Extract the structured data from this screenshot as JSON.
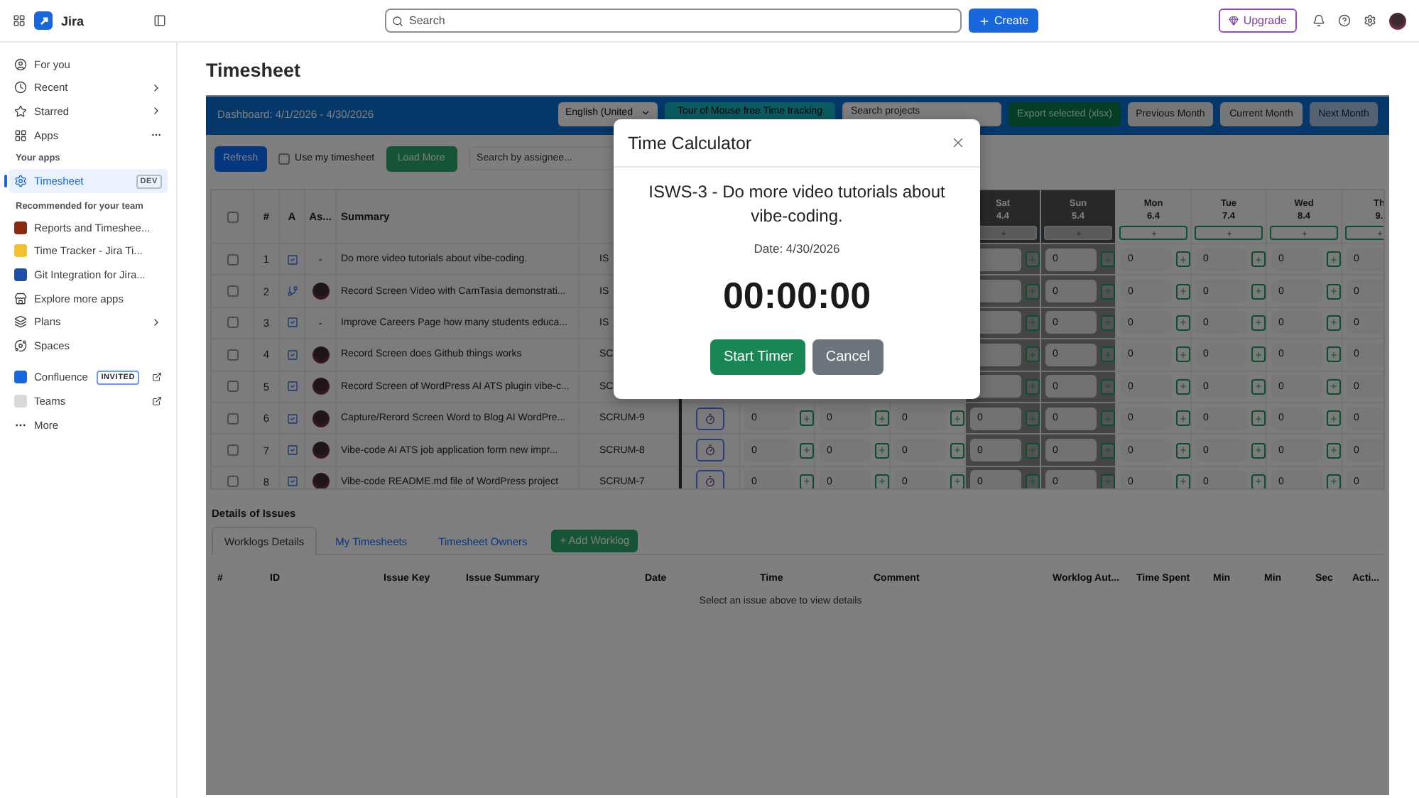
{
  "topbar": {
    "product": "Jira",
    "search_placeholder": "Search",
    "create": "Create",
    "upgrade": "Upgrade"
  },
  "sidebar": {
    "items": [
      {
        "kind": "nav",
        "label": "For you",
        "selected": false
      },
      {
        "kind": "nav",
        "label": "Recent",
        "selected": false,
        "expandable": true
      },
      {
        "kind": "nav",
        "label": "Starred",
        "selected": false,
        "expandable": true
      },
      {
        "kind": "nav",
        "label": "Apps",
        "selected": false,
        "has_menu": true
      },
      {
        "kind": "heading",
        "label": "Your apps"
      },
      {
        "kind": "nav",
        "label": "Timesheet",
        "selected": true,
        "badge": "DEV"
      },
      {
        "kind": "heading",
        "label": "Recommended for your team"
      },
      {
        "kind": "app",
        "label": "Reports and Timeshee...",
        "color": "#8a2c10",
        "selected": false
      },
      {
        "kind": "app",
        "label": "Time Tracker - Jira Ti...",
        "color": "#f2c230",
        "selected": false
      },
      {
        "kind": "app",
        "label": "Git Integration for Jira...",
        "color": "#1f4fa3",
        "selected": false
      },
      {
        "kind": "nav",
        "label": "Explore more apps",
        "selected": false
      },
      {
        "kind": "nav",
        "label": "Plans",
        "selected": false,
        "expandable": true
      },
      {
        "kind": "nav",
        "label": "Spaces",
        "selected": false
      },
      {
        "kind": "app",
        "label": "Confluence",
        "color": "#1868db",
        "selected": false,
        "badge": "INVITED",
        "external": true
      },
      {
        "kind": "app",
        "label": "Teams",
        "color": "#d9d9d9",
        "selected": false,
        "external": true
      },
      {
        "kind": "nav",
        "label": "More",
        "selected": false
      }
    ]
  },
  "page_title": "Timesheet",
  "header_bar": {
    "dashboard": "Dashboard: 4/1/2026 - 4/30/2026",
    "language": "English (United",
    "tour": "Tour of Mouse free Time tracking",
    "project_search_placeholder": "Search projects",
    "buttons": [
      {
        "label": "Export selected (xlsx)",
        "kind": "export"
      },
      {
        "label": "Previous Month",
        "kind": "nav"
      },
      {
        "label": "Current Month",
        "kind": "nav"
      },
      {
        "label": "Next Month",
        "kind": "current"
      }
    ]
  },
  "toolbar": {
    "refresh": "Refresh",
    "my_timesheet": {
      "label": "Use my timesheet",
      "checked": false
    },
    "load_more": "Load More",
    "assignee_placeholder": "Search by assignee..."
  },
  "table": {
    "all_checked": false,
    "columns": [
      "#",
      "A",
      "As...",
      "Summary"
    ],
    "day_columns": [
      {
        "day": "Sat",
        "date": "4.4",
        "weekend": true
      },
      {
        "day": "Sun",
        "date": "5.4",
        "weekend": true
      },
      {
        "day": "Mon",
        "date": "6.4",
        "weekend": false
      },
      {
        "day": "Tue",
        "date": "7.4",
        "weekend": false
      },
      {
        "day": "Wed",
        "date": "8.4",
        "weekend": false
      },
      {
        "day": "Th",
        "date": "9.",
        "weekend": false
      }
    ],
    "rows": [
      {
        "checked": false,
        "number": "1",
        "kind": "task",
        "avatar": false,
        "assignee": "-",
        "summary": "Do more video tutorials about vibe-coding.",
        "key": "IS",
        "hours": [
          "0",
          "0",
          "0",
          "0",
          "0"
        ]
      },
      {
        "checked": false,
        "number": "2",
        "kind": "subtask",
        "avatar": true,
        "summary": "Record Screen Video with CamTasia demonstrati...",
        "key": "IS",
        "hours": [
          "0",
          "0",
          "0",
          "0",
          "0"
        ]
      },
      {
        "checked": false,
        "number": "3",
        "kind": "task",
        "avatar": false,
        "assignee": "-",
        "summary": "Improve Careers Page how many students educa...",
        "key": "IS",
        "hours": [
          "0",
          "0",
          "0",
          "0",
          "0"
        ]
      },
      {
        "checked": false,
        "number": "4",
        "kind": "task",
        "avatar": true,
        "summary": "Record Screen does Github things works",
        "key": "SC",
        "hours": [
          "0",
          "0",
          "0",
          "0",
          "0"
        ]
      },
      {
        "checked": false,
        "number": "5",
        "kind": "task",
        "avatar": true,
        "summary": "Record Screen of WordPress AI ATS plugin vibe-c...",
        "key": "SC",
        "hours": [
          "0",
          "0",
          "0",
          "0",
          "0"
        ]
      },
      {
        "checked": false,
        "number": "6",
        "kind": "task",
        "avatar": true,
        "summary": "Capture/Rerord Screen Word to Blog AI WordPre...",
        "key": "SCRUM-9",
        "hours": [
          "0",
          "0",
          "0",
          "0",
          "0",
          "0",
          "0",
          "0",
          "0"
        ]
      },
      {
        "checked": false,
        "number": "7",
        "kind": "task",
        "avatar": true,
        "summary": "Vibe-code AI ATS job application form new impr...",
        "key": "SCRUM-8",
        "hours": [
          "0",
          "0",
          "0",
          "0",
          "0",
          "0",
          "0",
          "0",
          "0"
        ]
      },
      {
        "checked": false,
        "number": "8",
        "kind": "task",
        "avatar": true,
        "summary": "Vibe-code README.md file of WordPress project",
        "key": "SCRUM-7",
        "hours": [
          "0",
          "0",
          "0",
          "0",
          "0",
          "0",
          "0",
          "0",
          "0"
        ]
      }
    ]
  },
  "details": {
    "title": "Details of Issues",
    "tabs": [
      {
        "label": "Worklogs Details",
        "selected": true
      },
      {
        "label": "My Timesheets",
        "selected": false
      },
      {
        "label": "Timesheet Owners",
        "selected": false
      }
    ],
    "add_button": "+ Add Worklog",
    "columns": [
      "#",
      "ID",
      "Issue Key",
      "Issue Summary",
      "Date",
      "Time",
      "Comment",
      "Worklog Aut...",
      "Time Spent",
      "Min",
      "Min",
      "Sec",
      "Acti..."
    ],
    "empty_message": "Select an issue above to view details"
  },
  "modal": {
    "title": "Time Calculator",
    "heading": "ISWS-3 - Do more video tutorials about vibe-coding.",
    "date": "Date: 4/30/2026",
    "timer": "00:00:00",
    "buttons": [
      {
        "label": "Start Timer",
        "kind": "primary"
      },
      {
        "label": "Cancel",
        "kind": "secondary"
      }
    ]
  }
}
